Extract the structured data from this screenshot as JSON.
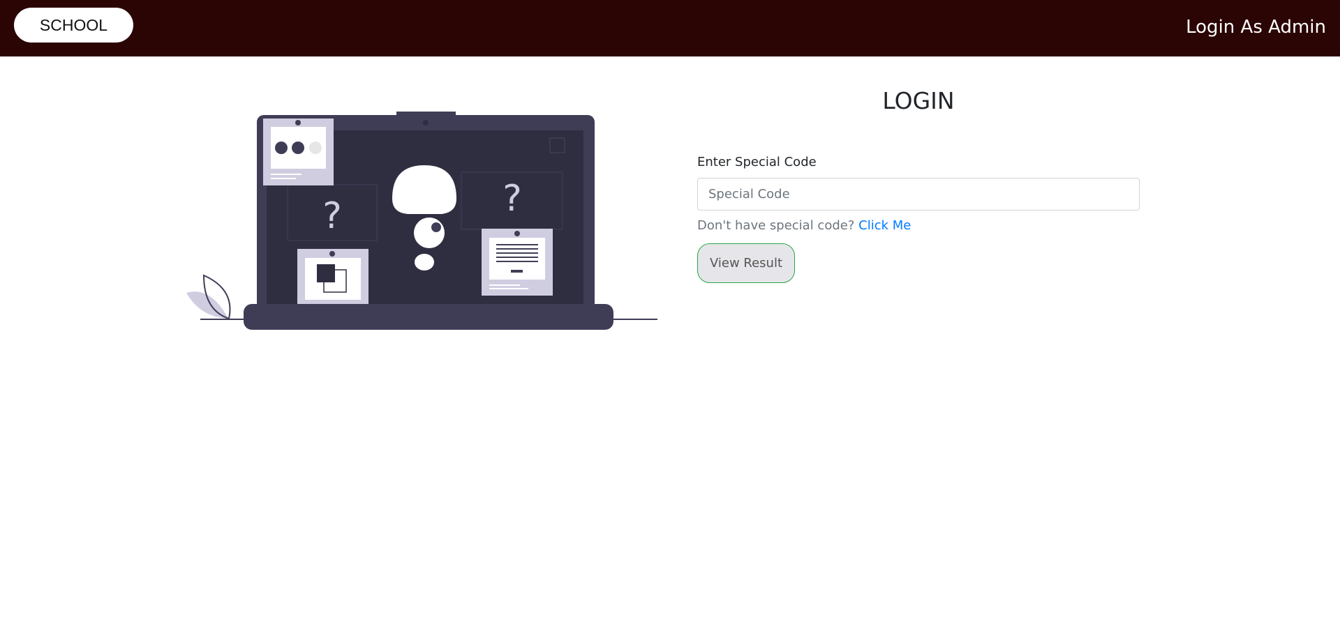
{
  "navbar": {
    "brand_label": "SCHOOL",
    "admin_link_label": "Login As Admin"
  },
  "illustration": {
    "question_mark": "?"
  },
  "login": {
    "title": "LOGIN",
    "code_label": "Enter Special Code",
    "code_value": "",
    "code_placeholder": "Special Code",
    "help_text": "Don't have special code?",
    "help_link": "Click Me",
    "submit_label": "View Result"
  },
  "colors": {
    "navbar_bg": "#2b0404",
    "link": "#007bff",
    "button_border": "#28a745",
    "laptop": "#3f3d56",
    "card": "#d0cde1"
  }
}
